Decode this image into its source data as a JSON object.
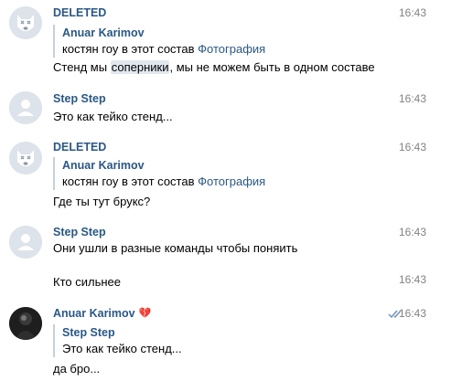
{
  "messages": [
    {
      "author": "DELETED",
      "time": "16:43",
      "quote": {
        "author": "Anuar Karimov",
        "text": "костян гоу в этот состав",
        "link": "Фотография"
      },
      "text_before": "Стенд мы ",
      "text_highlight": "соперники",
      "text_after": ", мы не можем быть в одном составе"
    },
    {
      "author": "Step Step",
      "time": "16:43",
      "text": "Это как тейко стенд..."
    },
    {
      "author": "DELETED",
      "time": "16:43",
      "quote": {
        "author": "Anuar Karimov",
        "text": "костян гоу в этот состав",
        "link": "Фотография"
      },
      "text": "Где ты тут брукс?"
    },
    {
      "author": "Step Step",
      "time": "16:43",
      "text": "Они ушли в разные команды чтобы поняить"
    },
    {
      "time": "16:43",
      "text": "Кто сильнее"
    },
    {
      "author": "Anuar Karimov",
      "time": "16:43",
      "quote": {
        "author": "Step Step",
        "text": "Это как тейко стенд..."
      },
      "text": "да бро..."
    }
  ],
  "icons": {
    "deleted_avatar": "dog-face-icon",
    "default_avatar": "user-silhouette-icon",
    "heart": "broken-heart-icon",
    "read_status": "double-check-icon"
  },
  "colors": {
    "author_link": "#2a5885",
    "timestamp": "#828282",
    "quote_bar": "#c5d0db",
    "highlight": "#e1e8f0",
    "heart": "#e0336b",
    "read_check": "#6c8eb4"
  }
}
